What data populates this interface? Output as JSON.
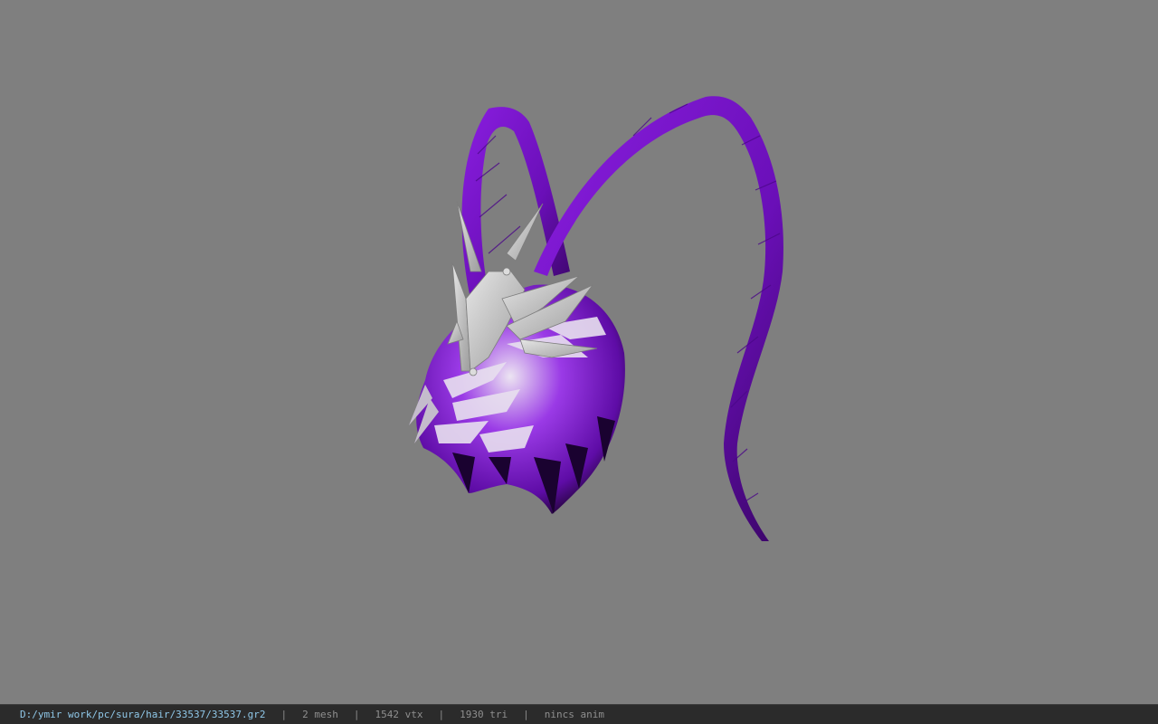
{
  "viewport": {
    "background_color": "#7f7f7f",
    "model": {
      "name": "hair-model",
      "hair_color": "#7a12cc",
      "hair_highlight_color": "#e8e0ef",
      "crown_color": "#c9c9c9"
    }
  },
  "status_bar": {
    "file_path": "D:/ymir work/pc/sura/hair/33537/33537.gr2",
    "separator": "|",
    "mesh_count": "2 mesh",
    "vertex_count": "1542 vtx",
    "triangle_count": "1930 tri",
    "animation_state": "nincs anim"
  }
}
